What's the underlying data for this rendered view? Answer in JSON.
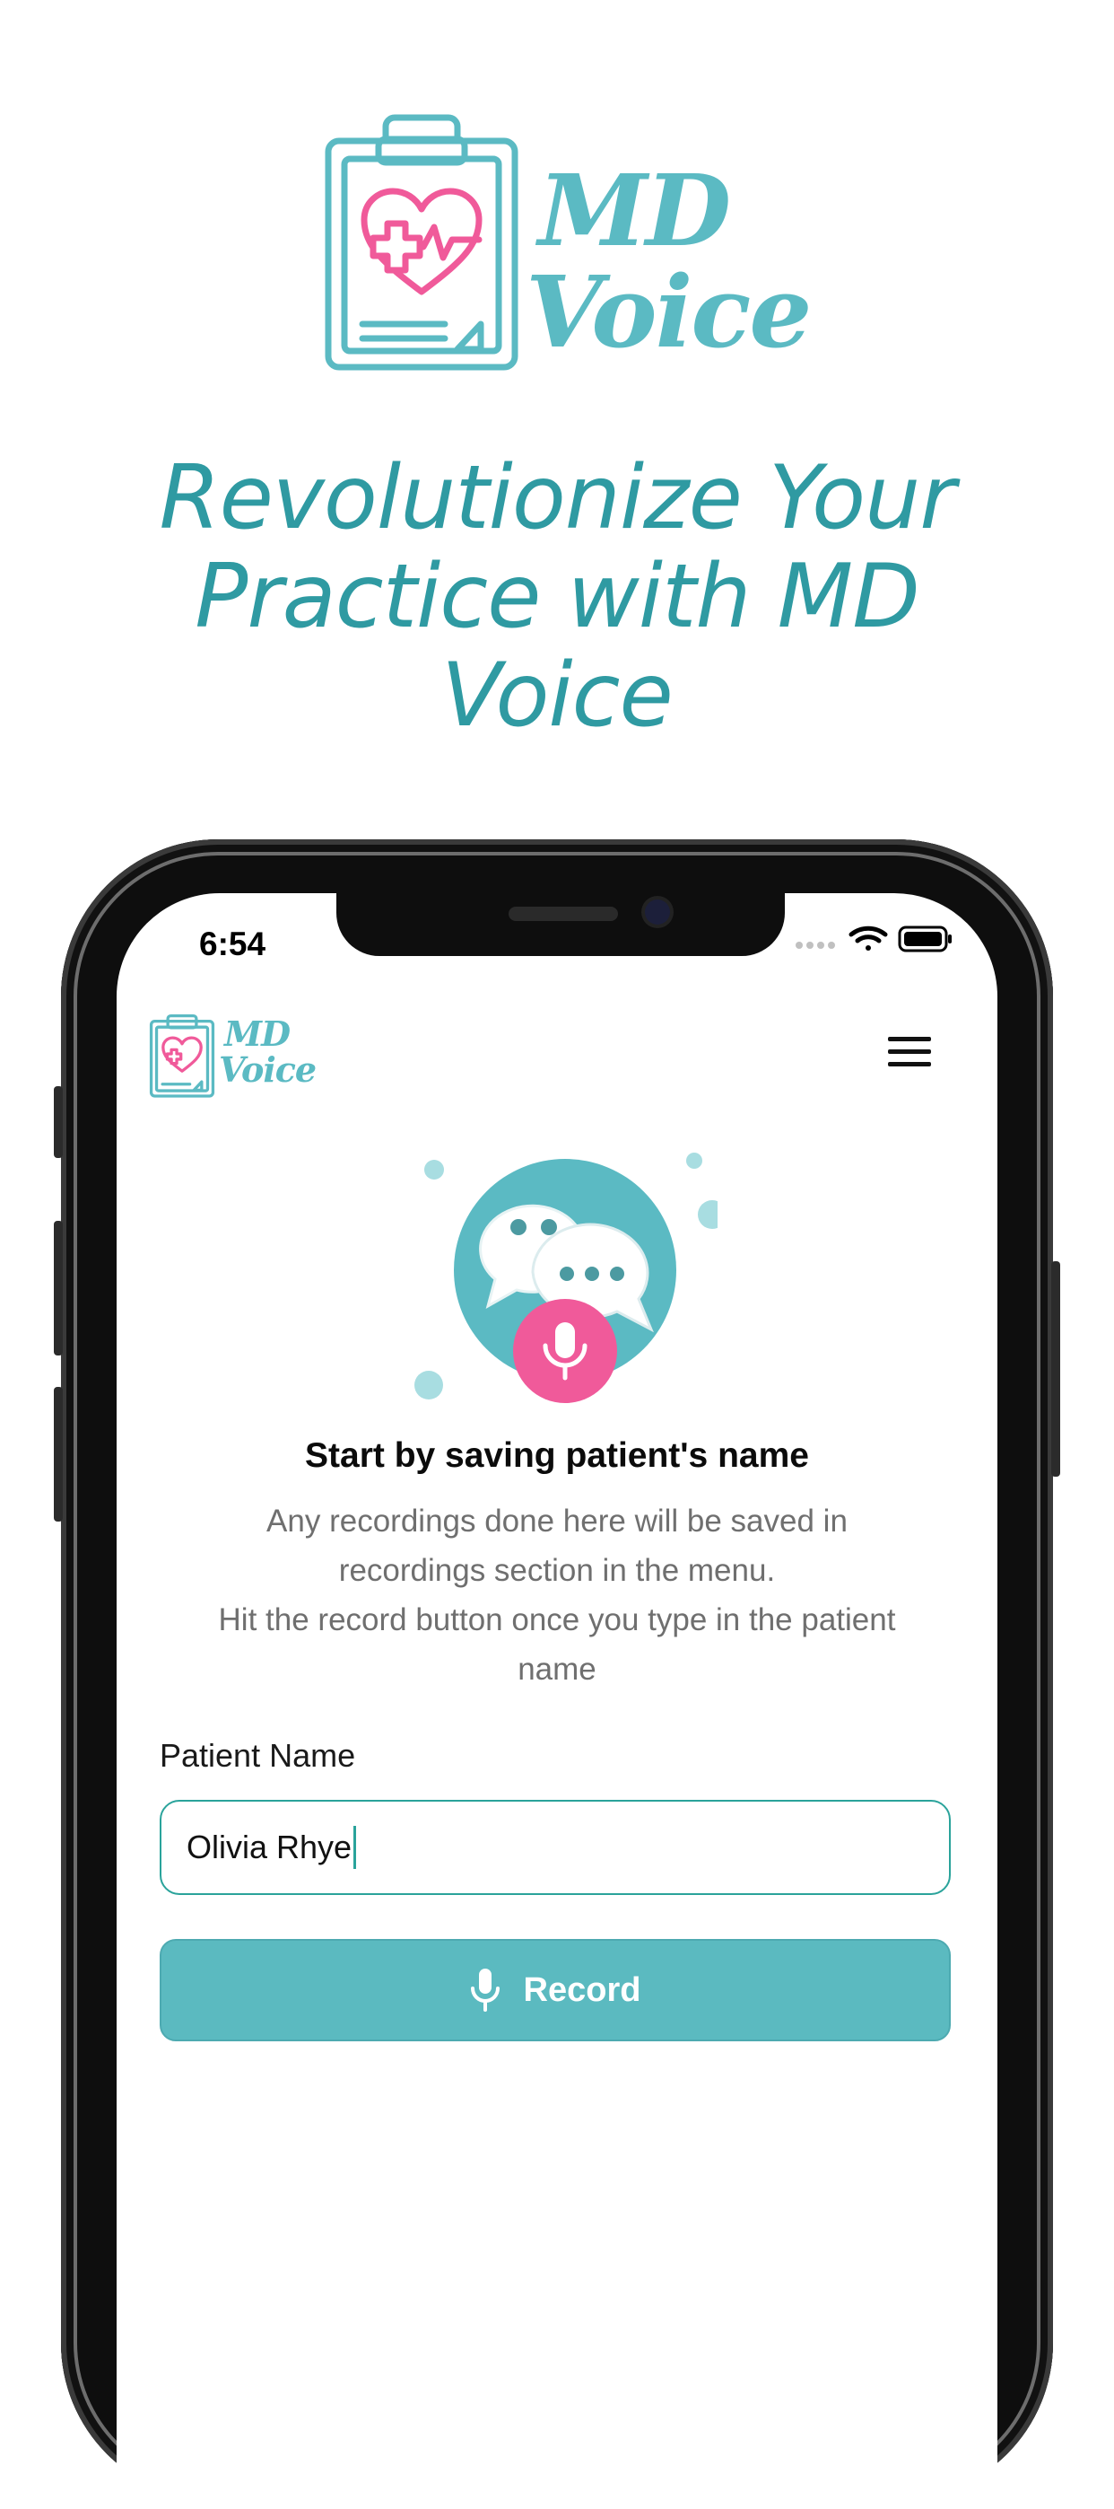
{
  "brand": {
    "name_line1": "MD",
    "name_line2": "Voice",
    "headline": "Revolutionize Your Practice with MD Voice"
  },
  "status_bar": {
    "time": "6:54"
  },
  "app_header": {
    "logo_line1": "MD",
    "logo_line2": "Voice",
    "menu_icon": "hamburger-icon"
  },
  "empty_state": {
    "title": "Start by saving patient's name",
    "body_line1": "Any recordings done here will be saved in recordings section in the menu.",
    "body_line2": "Hit the record button once you type in the patient name"
  },
  "form": {
    "patient_name_label": "Patient Name",
    "patient_name_value": "Olivia Rhye",
    "record_label": "Record"
  },
  "colors": {
    "teal": "#5bbac3",
    "headline": "#2f9aa2",
    "pink": "#f05a9a",
    "input_border": "#2aa39b"
  }
}
